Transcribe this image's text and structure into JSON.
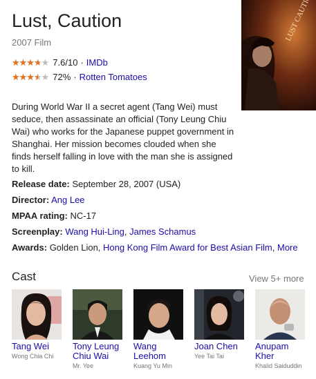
{
  "title": "Lust, Caution",
  "subtitle": "2007 Film",
  "ratings": [
    {
      "stars": 3.8,
      "score": "7.6/10",
      "separator": "·",
      "source": "IMDb"
    },
    {
      "stars": 3.6,
      "score": "72%",
      "separator": "·",
      "source": "Rotten Tomatoes"
    }
  ],
  "poster": {
    "title_text": "LUST CAUTION",
    "colors": [
      "#3a1a10",
      "#c8682a",
      "#1a0a05"
    ]
  },
  "description": "During World War II a secret agent (Tang Wei) must seduce, then assassinate an official (Tony Leung Chiu Wai) who works for the Japanese puppet government in Shanghai. Her mission becomes clouded when she finds herself falling in love with the man she is assigned to kill.",
  "facts": {
    "release": {
      "label": "Release date:",
      "value": "September 28, 2007 (USA)"
    },
    "director": {
      "label": "Director:",
      "value": "Ang Lee"
    },
    "mpaa": {
      "label": "MPAA rating:",
      "value": "NC-17"
    },
    "screenplay": {
      "label": "Screenplay:",
      "value1": "Wang Hui-Ling",
      "comma": ",",
      "value2": "James Schamus"
    },
    "awards": {
      "label": "Awards:",
      "text": "Golden Lion,",
      "link1": "Hong Kong Film Award for Best Asian Film",
      "comma": ",",
      "more": "More"
    }
  },
  "cast": {
    "heading": "Cast",
    "view_more": "View 5+ more",
    "members": [
      {
        "name": "Tang Wei",
        "role": "Wong Chia Chi"
      },
      {
        "name": "Tony Leung Chiu Wai",
        "role": "Mr. Yee"
      },
      {
        "name": "Wang Leehom",
        "role": "Kuang Yu Min"
      },
      {
        "name": "Joan Chen",
        "role": "Yee Tai Tai"
      },
      {
        "name": "Anupam Kher",
        "role": "Khalid Saiduddin"
      }
    ]
  },
  "colors": {
    "link": "#1a0dab",
    "star": "#e7711b",
    "muted": "#777777"
  }
}
